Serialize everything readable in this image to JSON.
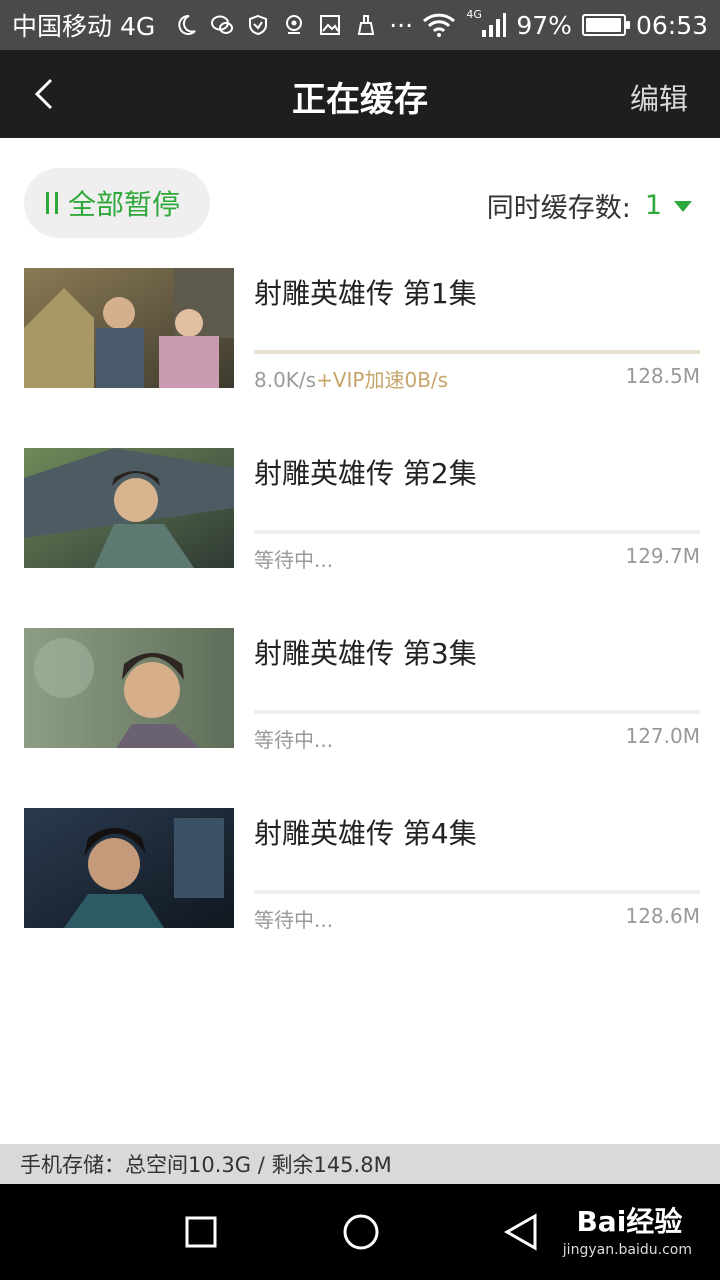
{
  "status_bar": {
    "carrier": "中国移动 4G",
    "icons": [
      "moon-icon",
      "wechat-icon",
      "vpn-icon",
      "location-icon",
      "gallery-icon",
      "broom-icon",
      "more-dots-icon",
      "wifi-icon",
      "signal-icon"
    ],
    "more": "···",
    "network_badge": "4G",
    "battery_percent": "97%",
    "battery_level": 0.97,
    "time": "06:53"
  },
  "title_bar": {
    "title": "正在缓存",
    "edit_label": "编辑"
  },
  "controls": {
    "pause_all_label": "全部暂停",
    "concurrent_label": "同时缓存数:",
    "concurrent_value": "1"
  },
  "downloads": [
    {
      "title": "射雕英雄传 第1集",
      "speed": "8.0K/s",
      "vip": "+VIP加速0B/s",
      "status": "",
      "size": "128.5M",
      "progress": 1.0
    },
    {
      "title": "射雕英雄传 第2集",
      "speed": "",
      "vip": "",
      "status": "等待中...",
      "size": "129.7M",
      "progress": 0
    },
    {
      "title": "射雕英雄传 第3集",
      "speed": "",
      "vip": "",
      "status": "等待中...",
      "size": "127.0M",
      "progress": 0
    },
    {
      "title": "射雕英雄传 第4集",
      "speed": "",
      "vip": "",
      "status": "等待中...",
      "size": "128.6M",
      "progress": 0
    }
  ],
  "footer": {
    "storage_text": "手机存储：总空间10.3G / 剩余145.8M"
  },
  "watermark": {
    "brand": "Bai经验",
    "url": "jingyan.baidu.com"
  },
  "colors": {
    "accent_green": "#2fa83a",
    "vip_gold": "#c6a46a",
    "title_bar_bg": "#1e1e1e",
    "status_bar_bg": "#4a4a4a"
  }
}
